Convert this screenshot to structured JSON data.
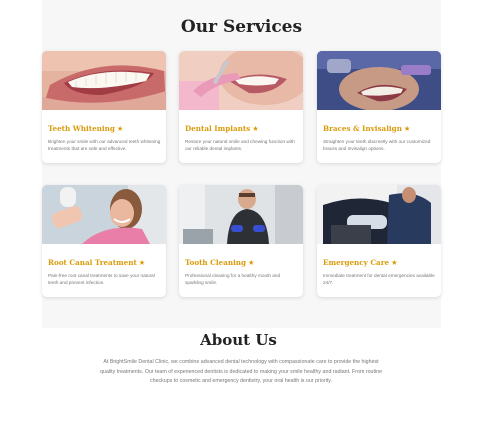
{
  "services": {
    "title": "Our Services",
    "cards": [
      {
        "title": "Teeth Whitening",
        "star": "★",
        "description": "Brighten your smile with our advanced teeth whitening treatments that are safe and effective."
      },
      {
        "title": "Dental Implants",
        "star": "★",
        "description": "Restore your natural smile and chewing function with our reliable dental implants."
      },
      {
        "title": "Braces & Invisalign",
        "star": "★",
        "description": "Straighten your teeth discreetly with our customized braces and Invisalign options."
      },
      {
        "title": "Root Canal Treatment",
        "star": "★",
        "description": "Pain-free root canal treatments to save your natural teeth and prevent infection."
      },
      {
        "title": "Tooth Cleaning",
        "star": "★",
        "description": "Professional cleaning for a healthy mouth and sparkling smile."
      },
      {
        "title": "Emergency Care",
        "star": "★",
        "description": "Immediate treatment for dental emergencies available 24/7."
      }
    ]
  },
  "about": {
    "title": "About Us",
    "text": "At BrightSmile Dental Clinic, we combine advanced dental technology with compassionate care to provide the highest quality treatments. Our team of experienced dentists is dedicated to making your smile healthy and radiant. From routine checkups to cosmetic and emergency dentistry, your oral health is our priority."
  },
  "colors": {
    "accent": "#d99b0b",
    "section_bg": "#f7f7f7",
    "heading": "#222222",
    "body_text": "#777777"
  }
}
